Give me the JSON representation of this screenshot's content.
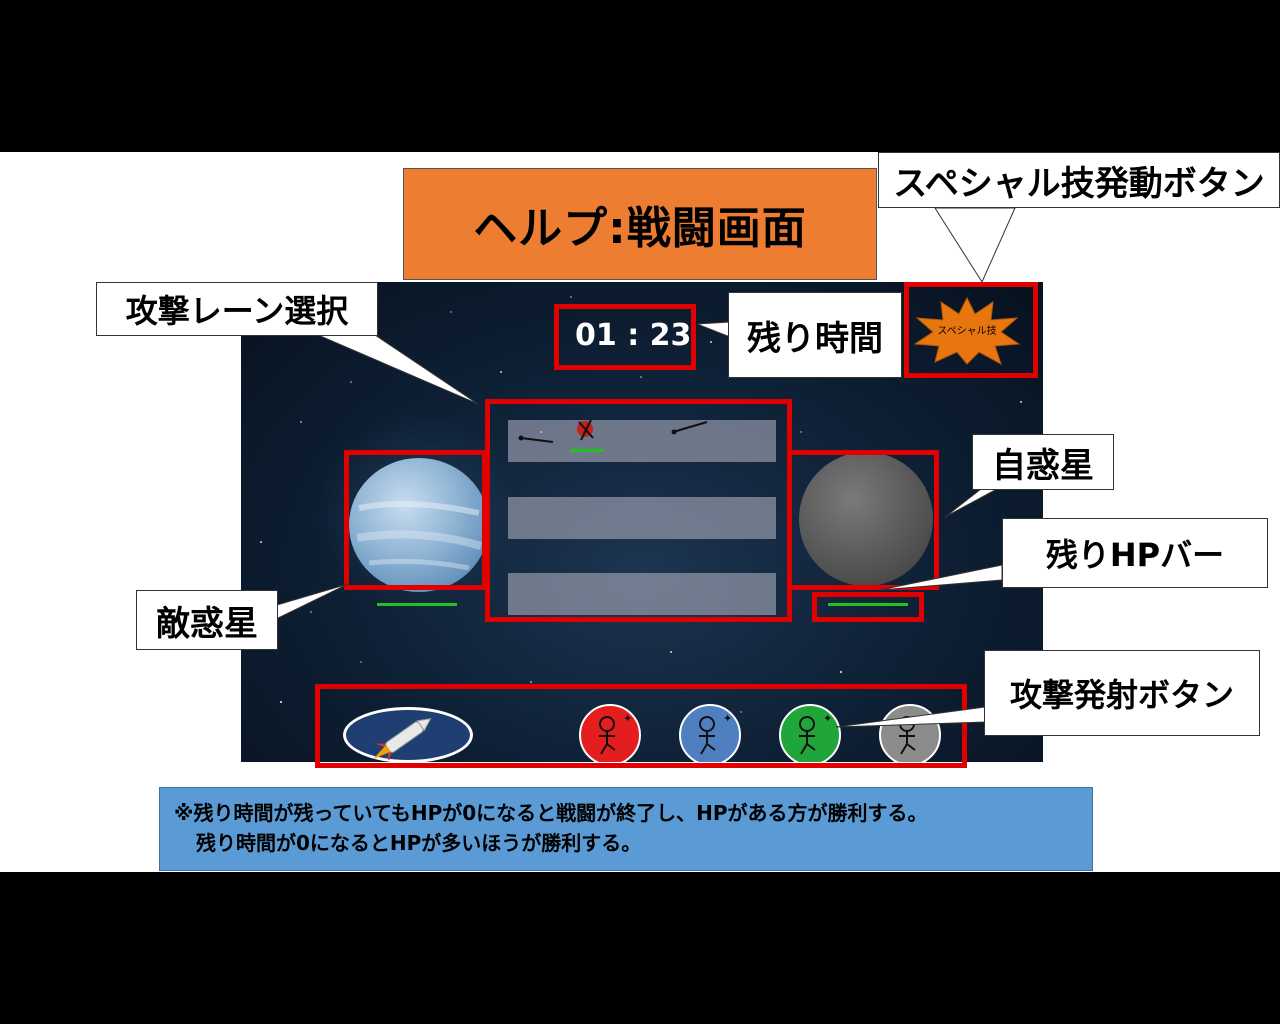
{
  "title": "ヘルプ:戦闘画面",
  "callouts": {
    "special": "スペシャル技発動ボタン",
    "lane_select": "攻撃レーン選択",
    "time_left": "残り時間",
    "own_planet": "自惑星",
    "hp_bar": "残りHPバー",
    "enemy_planet": "敵惑星",
    "fire_button": "攻撃発射ボタン"
  },
  "game": {
    "timer": "01 : 23",
    "special_label": "スペシャル技",
    "enemy_hp": 1.0,
    "own_hp": 1.0
  },
  "note": {
    "line1": "※残り時間が残っていてもHPが0になると戦闘が終了し、HPがある方が勝利する。",
    "line2": "残り時間が0になるとHPが多いほうが勝利する。"
  },
  "colors": {
    "title_bg": "#ED7D31",
    "highlight": "#E00000",
    "note_bg": "#5B9BD5",
    "hp_green": "#22C21C",
    "unit_colors": [
      "#E41E1E",
      "#4F7FC0",
      "#1FA53A",
      "#8C8C8C"
    ]
  }
}
